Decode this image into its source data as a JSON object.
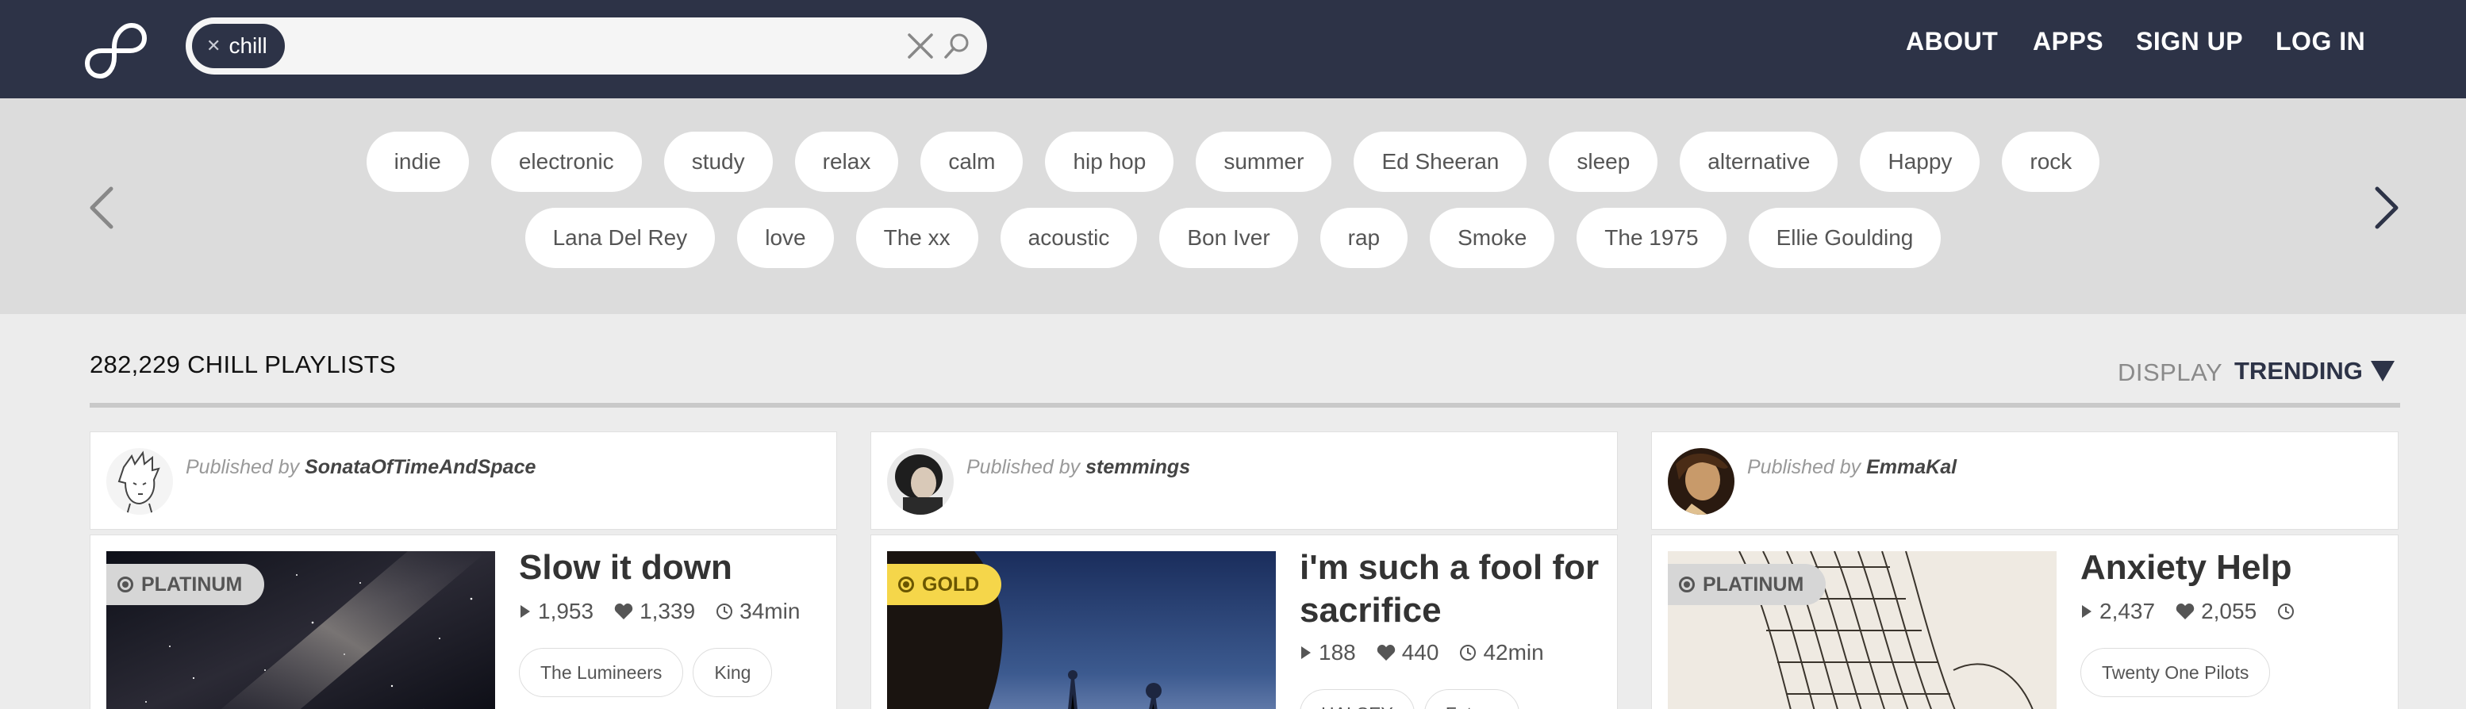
{
  "header": {
    "search_token": "chill",
    "nav": {
      "about": "ABOUT",
      "apps": "APPS",
      "signup": "SIGN UP",
      "login": "LOG IN"
    }
  },
  "tags": {
    "row1": [
      "indie",
      "electronic",
      "study",
      "relax",
      "calm",
      "hip hop",
      "summer",
      "Ed Sheeran",
      "sleep",
      "alternative",
      "Happy",
      "rock"
    ],
    "row2": [
      "Lana Del Rey",
      "love",
      "The xx",
      "acoustic",
      "Bon Iver",
      "rap",
      "Smoke",
      "The 1975",
      "Ellie Goulding"
    ]
  },
  "results": {
    "count_label": "282,229 CHILL PLAYLISTS",
    "display_label": "DISPLAY",
    "sort_label": "TRENDING"
  },
  "published_by_label": "Published by",
  "cards": [
    {
      "author": "SonataOfTimeAndSpace",
      "badge": "PLATINUM",
      "title": "Slow it down",
      "plays": "1,953",
      "likes": "1,339",
      "duration": "34min",
      "tags": [
        "The Lumineers",
        "King"
      ]
    },
    {
      "author": "stemmings",
      "badge": "GOLD",
      "title": "i'm such a fool for sacrifice",
      "plays": "188",
      "likes": "440",
      "duration": "42min",
      "tags": [
        "HALSEY",
        "Future"
      ]
    },
    {
      "author": "EmmaKal",
      "badge": "PLATINUM",
      "title": "Anxiety Help",
      "plays": "2,437",
      "likes": "2,055",
      "duration": "",
      "tags": [
        "Twenty One Pilots"
      ]
    }
  ],
  "colors": {
    "header_bg": "#2d3347",
    "tagstrip_bg": "#dcdcdc",
    "page_bg": "#ececec",
    "badge_platinum": "#d6d6d6",
    "badge_gold": "#f5d64a"
  },
  "icons": {
    "logo": "infinity-logo-icon",
    "clear": "close-icon",
    "search": "search-icon",
    "prev": "chevron-left-icon",
    "next": "chevron-right-icon",
    "sort": "triangle-down-icon",
    "plays": "play-icon",
    "likes": "heart-icon",
    "duration": "clock-icon"
  }
}
